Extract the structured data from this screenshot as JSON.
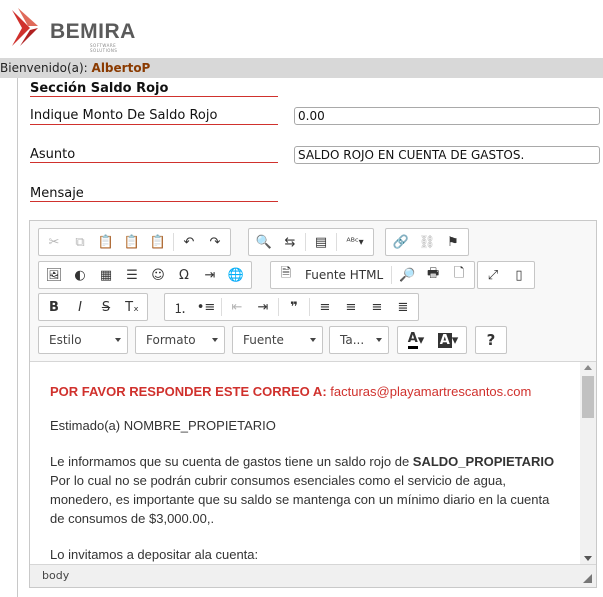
{
  "header": {
    "logo_text": "BEMIRA",
    "logo_subtext": "SOFTWARE SOLUTIONS",
    "welcome_prefix": "Bienvenido(a):",
    "username": "AlbertoP"
  },
  "form": {
    "section_title": "Sección Saldo Rojo",
    "amount_label": "Indique Monto De Saldo Rojo",
    "amount_value": "0.00",
    "subject_label": "Asunto",
    "subject_value": "SALDO ROJO EN CUENTA DE GASTOS.",
    "message_label": "Mensaje"
  },
  "editor": {
    "toolbar": {
      "source_label": "Fuente HTML",
      "style_combo": "Estilo",
      "format_combo": "Formato",
      "font_combo": "Fuente",
      "size_combo": "Ta...",
      "text_color": "A",
      "bg_color": "A",
      "help": "?"
    },
    "content": {
      "line1_strong": "POR FAVOR RESPONDER ESTE CORREO A:",
      "line1_link": "facturas@playamartrescantos.com",
      "greeting": "Estimado(a) NOMBRE_PROPIETARIO",
      "body_part1": "Le informamos que su cuenta de gastos tiene un saldo rojo de ",
      "body_bold": "SALDO_PROPIETARIO",
      "body_part2": "Por lo cual no se podrán cubrir consumos esenciales como el servicio de agua, monedero, es importante que su saldo se mantenga con un mínimo diario en la cuenta de consumos de $3,000.00,.",
      "closing": "Lo invitamos a depositar ala cuenta:"
    },
    "status_path": "body"
  },
  "colors": {
    "accent_red": "#d0312d",
    "link_red": "#d0312d"
  }
}
